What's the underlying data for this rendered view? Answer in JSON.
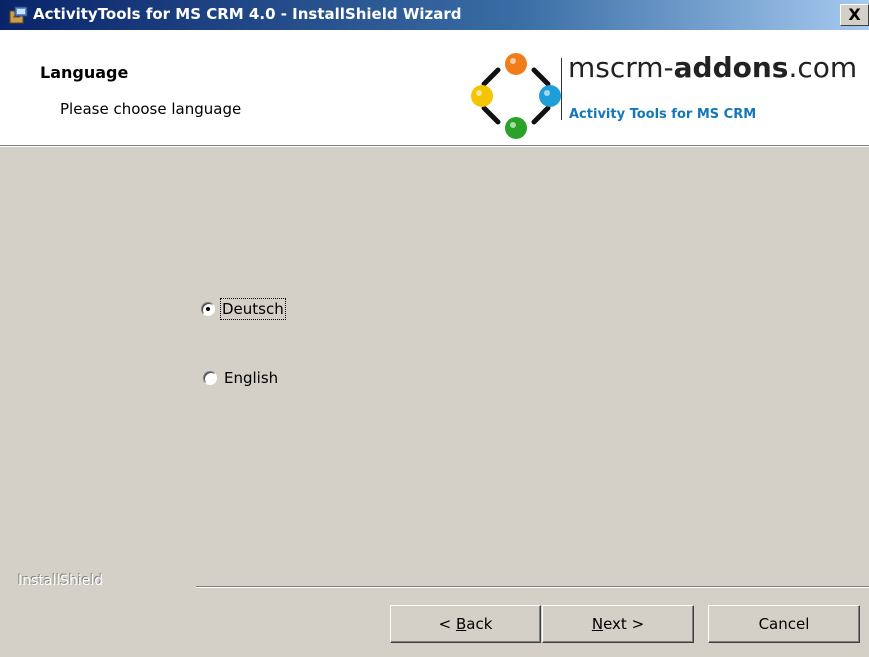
{
  "window": {
    "title": "ActivityTools for MS CRM 4.0 - InstallShield Wizard",
    "close_label": "X"
  },
  "header": {
    "title": "Language",
    "subtitle": "Please choose language",
    "logo": {
      "brand_prefix": "mscrm-",
      "brand_bold": "addons",
      "brand_suffix": ".com",
      "tagline": "Activity Tools for MS CRM",
      "colors": {
        "orange": "#f07d1a",
        "blue": "#1e9fd8",
        "green": "#2aa22a",
        "yellow": "#f5c400",
        "tagline": "#1478b8"
      }
    }
  },
  "language_options": [
    {
      "label": "Deutsch",
      "selected": true
    },
    {
      "label": "English",
      "selected": false
    }
  ],
  "footer": {
    "brand": "InstallShield",
    "buttons": {
      "back_prefix": "< ",
      "back_mnemonic": "B",
      "back_rest": "ack",
      "next_mnemonic": "N",
      "next_rest": "ext >",
      "cancel": "Cancel"
    }
  }
}
